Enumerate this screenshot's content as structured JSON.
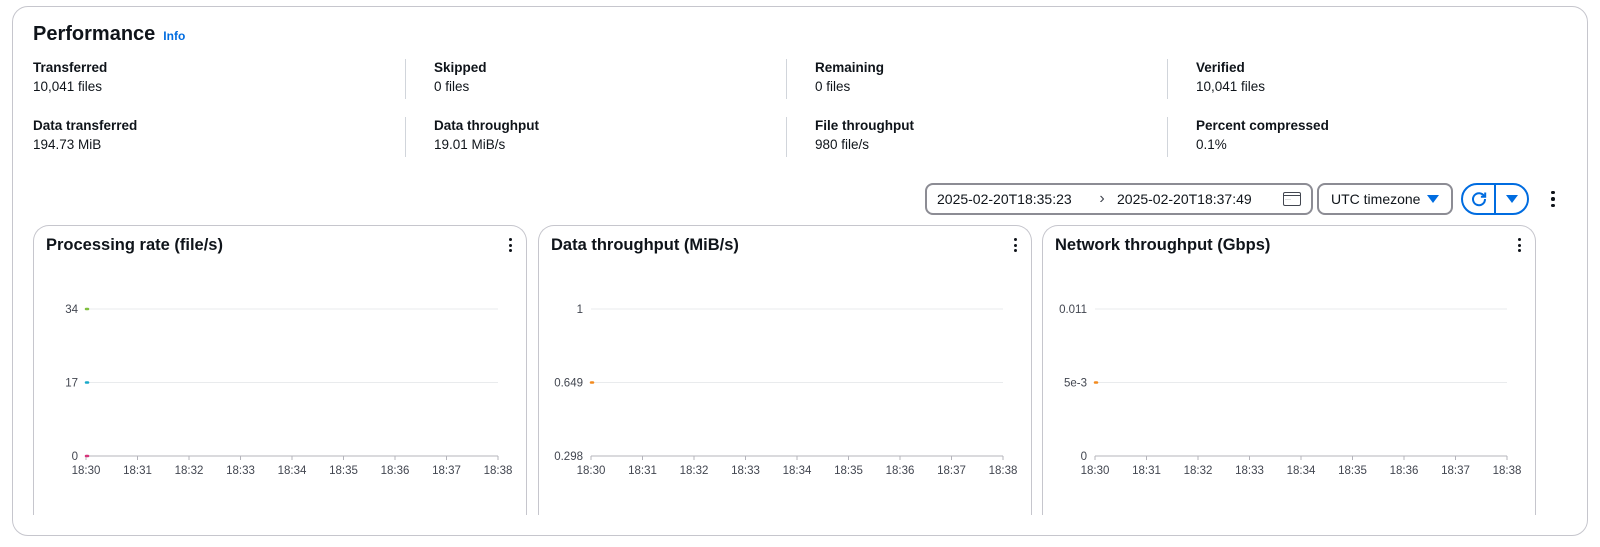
{
  "header": {
    "title": "Performance",
    "info": "Info"
  },
  "stats": [
    [
      {
        "label": "Transferred",
        "value": "10,041 files"
      },
      {
        "label": "Skipped",
        "value": "0 files"
      },
      {
        "label": "Remaining",
        "value": "0 files"
      },
      {
        "label": "Verified",
        "value": "10,041 files"
      }
    ],
    [
      {
        "label": "Data transferred",
        "value": "194.73 MiB"
      },
      {
        "label": "Data throughput",
        "value": "19.01 MiB/s"
      },
      {
        "label": "File throughput",
        "value": "980 file/s"
      },
      {
        "label": "Percent compressed",
        "value": "0.1%"
      }
    ]
  ],
  "controls": {
    "range_start": "2025-02-20T18:35:23",
    "range_end": "2025-02-20T18:37:49",
    "timezone": "UTC timezone",
    "icons": [
      "calendar-icon",
      "refresh-icon",
      "caret-down-icon",
      "more-options-icon"
    ]
  },
  "colors": {
    "accent": "#006ce0",
    "text": "#0f141a",
    "border": "#c6c6cd",
    "grid": "#e9ebed"
  },
  "chart_data": [
    {
      "type": "line",
      "title": "Processing rate (file/s)",
      "x": [
        "18:30",
        "18:31",
        "18:32",
        "18:33",
        "18:34",
        "18:35",
        "18:36",
        "18:37",
        "18:38"
      ],
      "ytick_labels": [
        "0",
        "17",
        "34"
      ],
      "ylim": [
        0,
        34
      ],
      "series": [
        {
          "color": "#7fbf3f",
          "points": [
            [
              "18:30",
              34
            ]
          ]
        },
        {
          "color": "#18a9c9",
          "points": [
            [
              "18:30",
              17
            ]
          ]
        },
        {
          "color": "#d6337a",
          "points": [
            [
              "18:30",
              0
            ]
          ]
        }
      ]
    },
    {
      "type": "line",
      "title": "Data throughput (MiB/s)",
      "x": [
        "18:30",
        "18:31",
        "18:32",
        "18:33",
        "18:34",
        "18:35",
        "18:36",
        "18:37",
        "18:38"
      ],
      "ytick_labels": [
        "0.298",
        "0.649",
        "1"
      ],
      "ylim": [
        0.298,
        1
      ],
      "series": [
        {
          "color": "#f28a1f",
          "points": [
            [
              "18:30",
              0.649
            ]
          ]
        }
      ]
    },
    {
      "type": "line",
      "title": "Network throughput (Gbps)",
      "x": [
        "18:30",
        "18:31",
        "18:32",
        "18:33",
        "18:34",
        "18:35",
        "18:36",
        "18:37",
        "18:38"
      ],
      "ytick_labels": [
        "0",
        "5e-3",
        "0.011"
      ],
      "ylim": [
        0,
        0.011
      ],
      "series": [
        {
          "color": "#f28a1f",
          "points": [
            [
              "18:30",
              0.0055
            ]
          ]
        }
      ]
    }
  ]
}
